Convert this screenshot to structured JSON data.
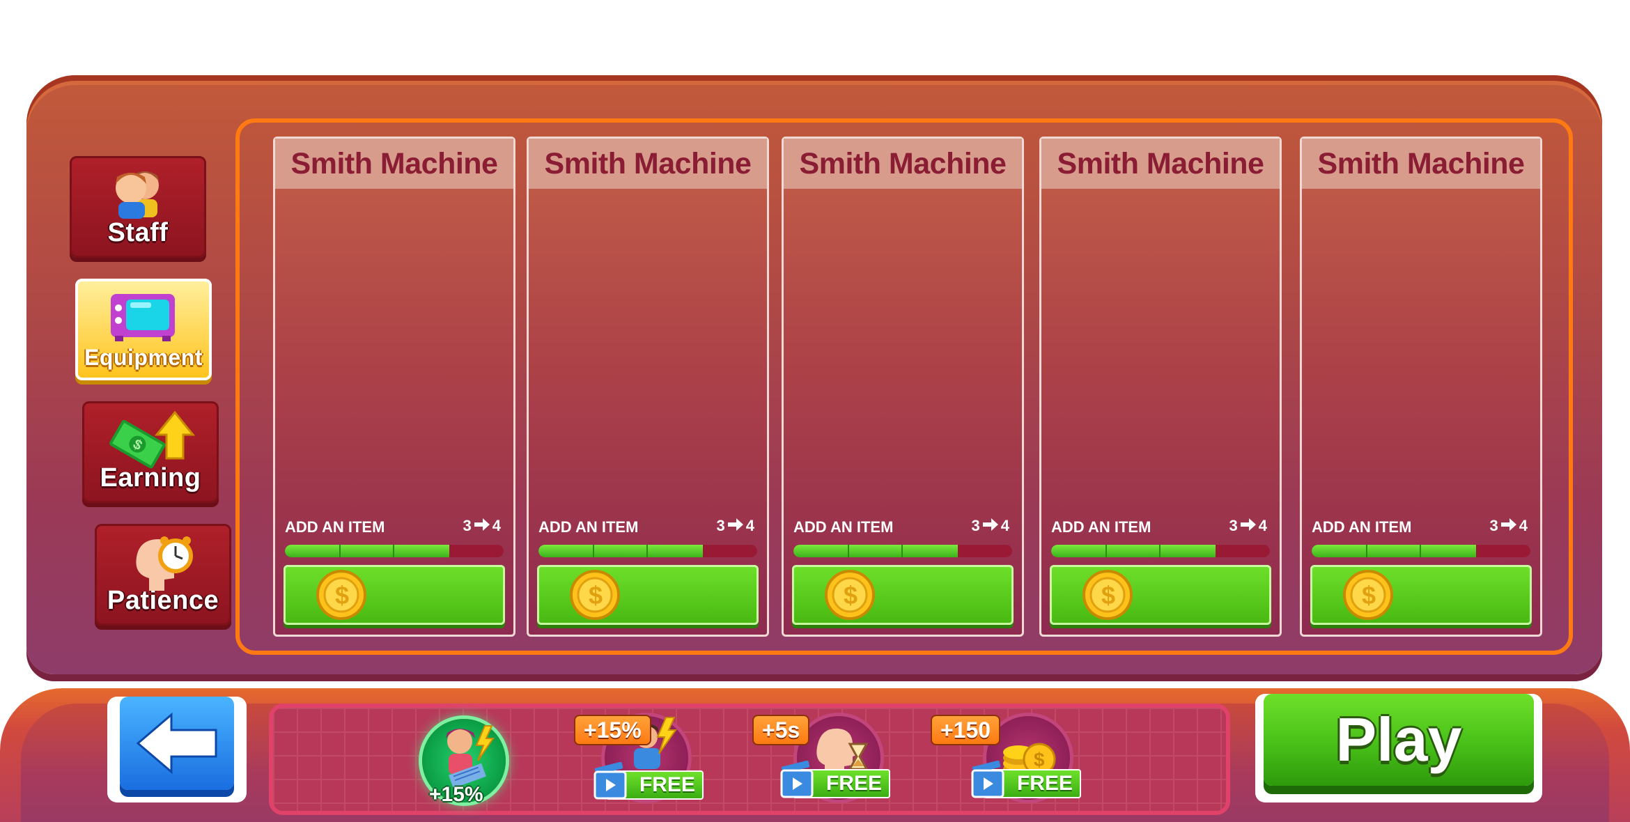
{
  "tabs": [
    {
      "label": "Staff",
      "icon": "staff-icon",
      "active": false
    },
    {
      "label": "Equipment",
      "icon": "equipment-icon",
      "active": true
    },
    {
      "label": "Earning",
      "icon": "earning-icon",
      "active": false
    },
    {
      "label": "Patience",
      "icon": "patience-icon",
      "active": false
    }
  ],
  "cards": [
    {
      "title": "Smith Machine",
      "action_label": "ADD AN ITEM",
      "level_from": "3",
      "level_to": "4",
      "progress": 0.75
    },
    {
      "title": "Smith Machine",
      "action_label": "ADD AN ITEM",
      "level_from": "3",
      "level_to": "4",
      "progress": 0.75
    },
    {
      "title": "Smith Machine",
      "action_label": "ADD AN ITEM",
      "level_from": "3",
      "level_to": "4",
      "progress": 0.75
    },
    {
      "title": "Smith Machine",
      "action_label": "ADD AN ITEM",
      "level_from": "3",
      "level_to": "4",
      "progress": 0.75
    },
    {
      "title": "Smith Machine",
      "action_label": "ADD AN ITEM",
      "level_from": "3",
      "level_to": "4",
      "progress": 0.75
    }
  ],
  "boosts": [
    {
      "label": "+15%",
      "icon": "trainer-boost-icon",
      "active": true
    },
    {
      "badge": "+15%",
      "free_label": "FREE",
      "icon": "staff-speed-icon"
    },
    {
      "badge": "+5s",
      "free_label": "FREE",
      "icon": "patience-time-icon"
    },
    {
      "badge": "+150",
      "free_label": "FREE",
      "icon": "coins-icon"
    }
  ],
  "back_icon": "back-arrow-icon",
  "play_label": "Play",
  "colors": {
    "accent_orange": "#ff7a12",
    "button_green": "#48c018",
    "tab_red": "#a01c26",
    "tab_active": "#ffc21a"
  }
}
